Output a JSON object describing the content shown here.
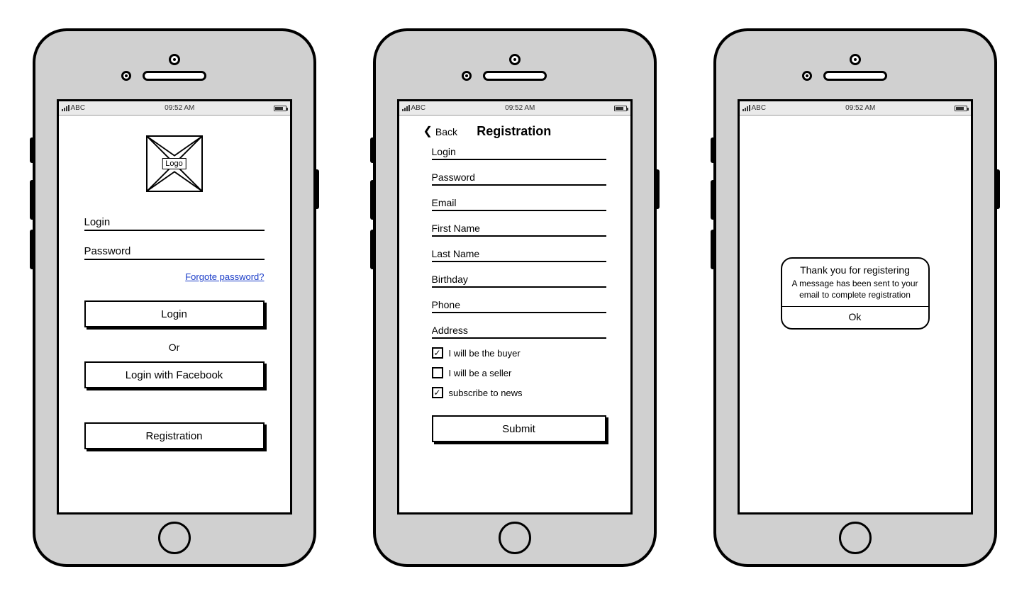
{
  "statusbar": {
    "carrier": "ABC",
    "time": "09:52 AM"
  },
  "screen1": {
    "logo_label": "Logo",
    "login_placeholder": "Login",
    "password_placeholder": "Password",
    "forgot_link": "Forgote password?",
    "login_button": "Login",
    "or_text": "Or",
    "facebook_button": "Login with Facebook",
    "registration_button": "Registration"
  },
  "screen2": {
    "back_label": "Back",
    "title": "Registration",
    "fields": {
      "login": "Login",
      "password": "Password",
      "email": "Email",
      "first_name": "First Name",
      "last_name": "Last Name",
      "birthday": "Birthday",
      "phone": "Phone",
      "address": "Address"
    },
    "checkboxes": {
      "buyer": {
        "label": "I will be the buyer",
        "checked": true
      },
      "seller": {
        "label": "I will be a seller",
        "checked": false
      },
      "news": {
        "label": "subscribe to news",
        "checked": true
      }
    },
    "submit_button": "Submit"
  },
  "screen3": {
    "dialog_title": "Thank you for registering",
    "dialog_body": "A message has been sent to your email to complete registration",
    "dialog_ok": "Ok"
  }
}
